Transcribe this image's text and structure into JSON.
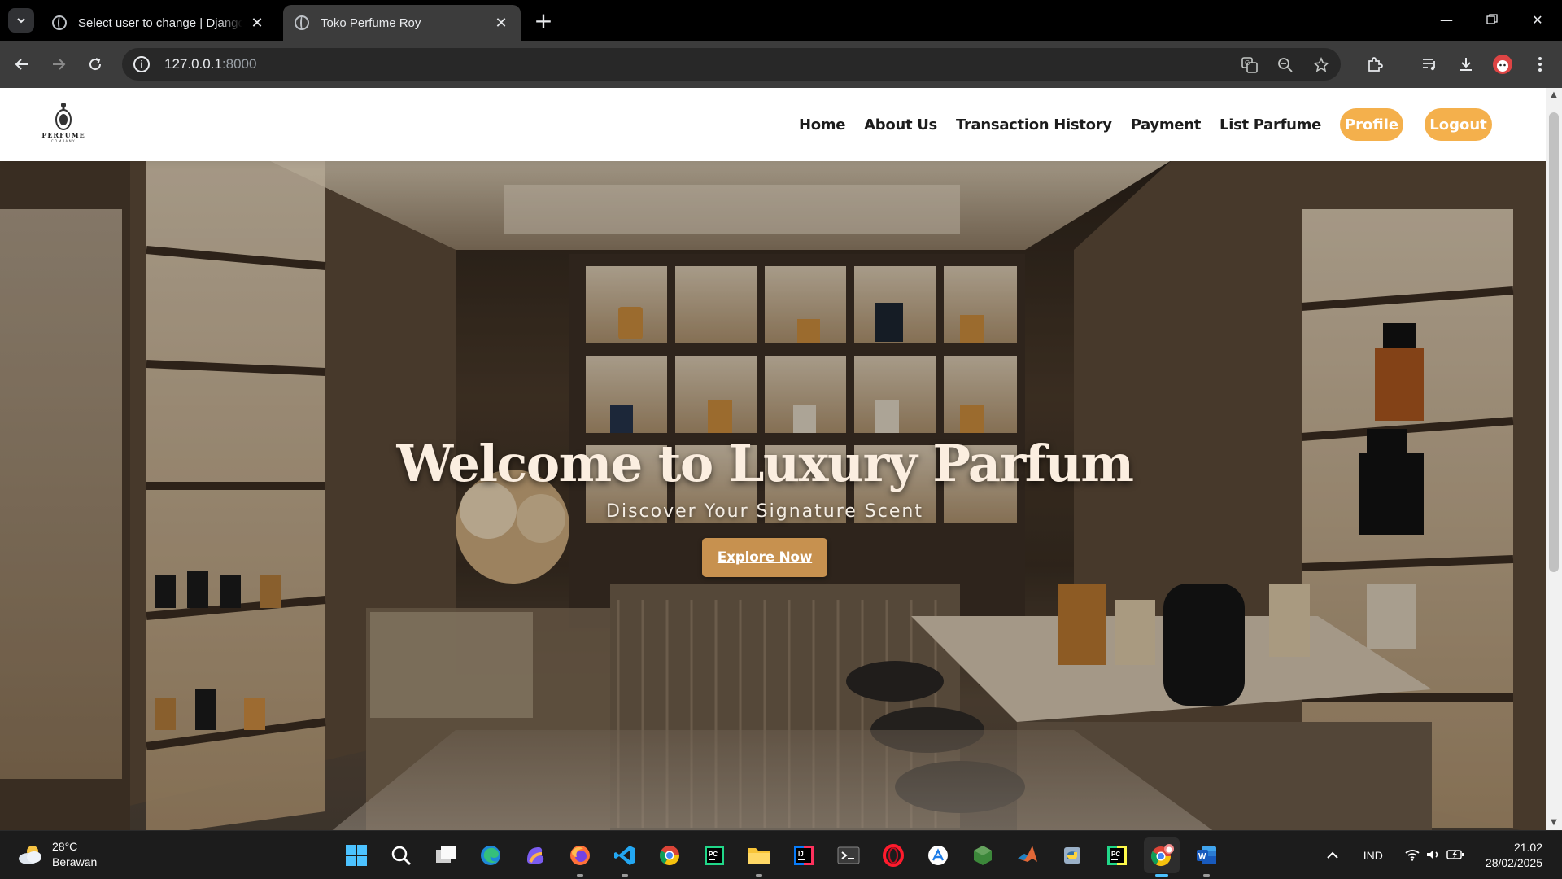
{
  "browser": {
    "tabs": [
      {
        "title": "Select user to change | Django site admin",
        "active": false
      },
      {
        "title": "Toko Perfume Roy",
        "active": true
      }
    ],
    "url_host": "127.0.0.1",
    "url_port": ":8000",
    "window_controls": [
      "minimize-icon",
      "restore-icon",
      "close-icon"
    ]
  },
  "site": {
    "logo_text": "PERFUME",
    "logo_subtext": "COMPANY",
    "nav": {
      "home": "Home",
      "about": "About Us",
      "history": "Transaction History",
      "payment": "Payment",
      "list": "List Parfume",
      "profile": "Profile",
      "logout": "Logout"
    },
    "hero": {
      "title": "Welcome to Luxury Parfum",
      "subtitle": "Discover Your Signature Scent",
      "button": "Explore Now"
    },
    "colors": {
      "accent": "#f4b04c",
      "button": "#c7914f"
    }
  },
  "taskbar": {
    "weather_temp": "28°C",
    "weather_desc": "Berawan",
    "language": "IND",
    "time": "21.02",
    "date": "28/02/2025",
    "apps": [
      "windows-start-icon",
      "search-icon",
      "task-view-icon",
      "edge-icon",
      "copilot-icon",
      "firefox-icon",
      "vscode-icon",
      "chrome-icon",
      "pycharm-icon",
      "file-explorer-icon",
      "intellij-icon",
      "terminal-icon",
      "opera-icon",
      "altstore-icon",
      "nodejs-icon",
      "matlab-icon",
      "python-icon",
      "pycharm-pro-icon",
      "chrome-profile-icon",
      "word-icon"
    ]
  }
}
